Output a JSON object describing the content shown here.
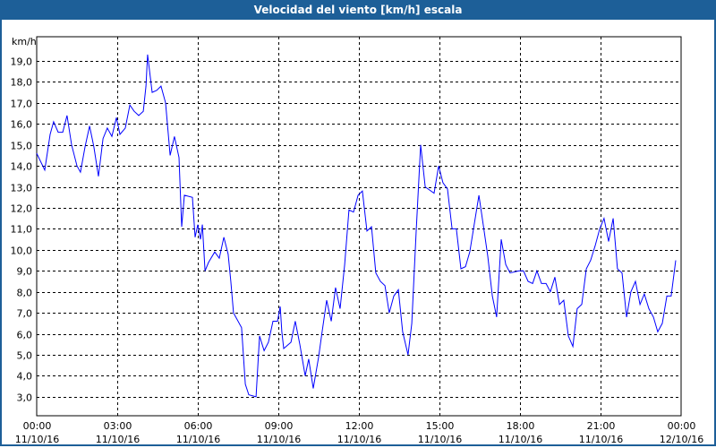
{
  "window": {
    "title": "Velocidad del viento [km/h] escala"
  },
  "chart_data": {
    "type": "line",
    "title": "Velocidad del viento [km/h] escala",
    "ylabel": "km/h",
    "xlabel": "",
    "ylim": [
      2.1,
      20.15
    ],
    "xlim_hours": [
      0,
      24
    ],
    "grid": true,
    "line_color": "#0000ff",
    "y_ticks": [
      {
        "value": 3,
        "label": "3,0"
      },
      {
        "value": 4,
        "label": "4,0"
      },
      {
        "value": 5,
        "label": "5,0"
      },
      {
        "value": 6,
        "label": "6,0"
      },
      {
        "value": 7,
        "label": "7,0"
      },
      {
        "value": 8,
        "label": "8,0"
      },
      {
        "value": 9,
        "label": "9,0"
      },
      {
        "value": 10,
        "label": "10,0"
      },
      {
        "value": 11,
        "label": "11,0"
      },
      {
        "value": 12,
        "label": "12,0"
      },
      {
        "value": 13,
        "label": "13,0"
      },
      {
        "value": 14,
        "label": "14,0"
      },
      {
        "value": 15,
        "label": "15,0"
      },
      {
        "value": 16,
        "label": "16,0"
      },
      {
        "value": 17,
        "label": "17,0"
      },
      {
        "value": 18,
        "label": "18,0"
      },
      {
        "value": 19,
        "label": "19,0"
      }
    ],
    "x_ticks": [
      {
        "hour": 0,
        "time": "00:00",
        "date": "11/10/16"
      },
      {
        "hour": 3,
        "time": "03:00",
        "date": "11/10/16"
      },
      {
        "hour": 6,
        "time": "06:00",
        "date": "11/10/16"
      },
      {
        "hour": 9,
        "time": "09:00",
        "date": "11/10/16"
      },
      {
        "hour": 12,
        "time": "12:00",
        "date": "11/10/16"
      },
      {
        "hour": 15,
        "time": "15:00",
        "date": "11/10/16"
      },
      {
        "hour": 18,
        "time": "18:00",
        "date": "11/10/16"
      },
      {
        "hour": 21,
        "time": "21:00",
        "date": "11/10/16"
      },
      {
        "hour": 24,
        "time": "00:00",
        "date": "12/10/16"
      }
    ],
    "series": [
      {
        "name": "Velocidad del viento",
        "points": [
          [
            0,
            14.6
          ],
          [
            0.3,
            13.8
          ],
          [
            0.5,
            15.5
          ],
          [
            0.63,
            16.1
          ],
          [
            0.8,
            15.6
          ],
          [
            0.97,
            15.6
          ],
          [
            1.13,
            16.4
          ],
          [
            1.3,
            15.0
          ],
          [
            1.5,
            14.0
          ],
          [
            1.63,
            13.7
          ],
          [
            1.8,
            14.9
          ],
          [
            1.97,
            15.9
          ],
          [
            2.13,
            14.9
          ],
          [
            2.3,
            13.5
          ],
          [
            2.47,
            15.3
          ],
          [
            2.63,
            15.8
          ],
          [
            2.8,
            15.4
          ],
          [
            2.97,
            16.3
          ],
          [
            3.1,
            15.5
          ],
          [
            3.3,
            15.8
          ],
          [
            3.47,
            16.9
          ],
          [
            3.63,
            16.6
          ],
          [
            3.8,
            16.4
          ],
          [
            3.97,
            16.6
          ],
          [
            4.07,
            17.8
          ],
          [
            4.13,
            19.3
          ],
          [
            4.3,
            17.5
          ],
          [
            4.47,
            17.6
          ],
          [
            4.63,
            17.8
          ],
          [
            4.8,
            17.0
          ],
          [
            4.97,
            14.5
          ],
          [
            5.13,
            15.4
          ],
          [
            5.3,
            14.4
          ],
          [
            5.4,
            11.1
          ],
          [
            5.5,
            12.6
          ],
          [
            5.8,
            12.5
          ],
          [
            5.9,
            10.6
          ],
          [
            6.0,
            11.2
          ],
          [
            6.1,
            10.5
          ],
          [
            6.17,
            11.2
          ],
          [
            6.27,
            9.0
          ],
          [
            6.4,
            9.4
          ],
          [
            6.63,
            9.9
          ],
          [
            6.8,
            9.6
          ],
          [
            6.97,
            10.6
          ],
          [
            7.13,
            9.8
          ],
          [
            7.23,
            8.5
          ],
          [
            7.33,
            7.0
          ],
          [
            7.63,
            6.3
          ],
          [
            7.77,
            3.6
          ],
          [
            7.9,
            3.1
          ],
          [
            8.17,
            3.0
          ],
          [
            8.3,
            5.9
          ],
          [
            8.47,
            5.2
          ],
          [
            8.63,
            5.6
          ],
          [
            8.8,
            6.6
          ],
          [
            8.97,
            6.6
          ],
          [
            9.07,
            7.3
          ],
          [
            9.13,
            6.1
          ],
          [
            9.2,
            5.3
          ],
          [
            9.47,
            5.6
          ],
          [
            9.63,
            6.6
          ],
          [
            9.8,
            5.5
          ],
          [
            10.0,
            4.0
          ],
          [
            10.13,
            4.8
          ],
          [
            10.3,
            3.4
          ],
          [
            10.5,
            4.9
          ],
          [
            10.63,
            6.1
          ],
          [
            10.8,
            7.6
          ],
          [
            10.97,
            6.6
          ],
          [
            11.13,
            8.2
          ],
          [
            11.3,
            7.2
          ],
          [
            11.47,
            9.3
          ],
          [
            11.63,
            11.9
          ],
          [
            11.8,
            11.8
          ],
          [
            11.97,
            12.6
          ],
          [
            12.13,
            12.8
          ],
          [
            12.3,
            10.9
          ],
          [
            12.47,
            11.1
          ],
          [
            12.63,
            8.9
          ],
          [
            12.8,
            8.5
          ],
          [
            12.97,
            8.3
          ],
          [
            13.13,
            7.0
          ],
          [
            13.3,
            7.8
          ],
          [
            13.47,
            8.1
          ],
          [
            13.63,
            6.1
          ],
          [
            13.83,
            5.0
          ],
          [
            13.97,
            6.5
          ],
          [
            14.13,
            10.8
          ],
          [
            14.3,
            15.0
          ],
          [
            14.47,
            13.0
          ],
          [
            14.8,
            12.7
          ],
          [
            14.97,
            14.0
          ],
          [
            15.13,
            13.2
          ],
          [
            15.3,
            12.9
          ],
          [
            15.47,
            11.0
          ],
          [
            15.63,
            11.0
          ],
          [
            15.8,
            9.1
          ],
          [
            15.97,
            9.2
          ],
          [
            16.13,
            9.9
          ],
          [
            16.47,
            12.6
          ],
          [
            16.63,
            11.2
          ],
          [
            16.8,
            9.7
          ],
          [
            16.97,
            7.8
          ],
          [
            17.13,
            6.8
          ],
          [
            17.3,
            10.5
          ],
          [
            17.47,
            9.3
          ],
          [
            17.63,
            8.9
          ],
          [
            17.97,
            9.0
          ],
          [
            18.13,
            9.0
          ],
          [
            18.3,
            8.5
          ],
          [
            18.47,
            8.4
          ],
          [
            18.63,
            9.0
          ],
          [
            18.8,
            8.4
          ],
          [
            18.97,
            8.4
          ],
          [
            19.13,
            8.0
          ],
          [
            19.3,
            8.7
          ],
          [
            19.47,
            7.4
          ],
          [
            19.63,
            7.6
          ],
          [
            19.8,
            5.9
          ],
          [
            19.97,
            5.4
          ],
          [
            20.13,
            7.2
          ],
          [
            20.3,
            7.4
          ],
          [
            20.47,
            9.1
          ],
          [
            20.63,
            9.5
          ],
          [
            20.8,
            10.2
          ],
          [
            20.97,
            11.0
          ],
          [
            21.13,
            11.5
          ],
          [
            21.3,
            10.4
          ],
          [
            21.47,
            11.5
          ],
          [
            21.63,
            9.1
          ],
          [
            21.8,
            8.9
          ],
          [
            21.97,
            6.8
          ],
          [
            22.13,
            8.0
          ],
          [
            22.3,
            8.5
          ],
          [
            22.47,
            7.4
          ],
          [
            22.63,
            7.9
          ],
          [
            22.8,
            7.2
          ],
          [
            22.97,
            6.8
          ],
          [
            23.13,
            6.1
          ],
          [
            23.3,
            6.5
          ],
          [
            23.47,
            7.8
          ],
          [
            23.63,
            7.8
          ],
          [
            23.8,
            9.5
          ]
        ]
      }
    ]
  }
}
